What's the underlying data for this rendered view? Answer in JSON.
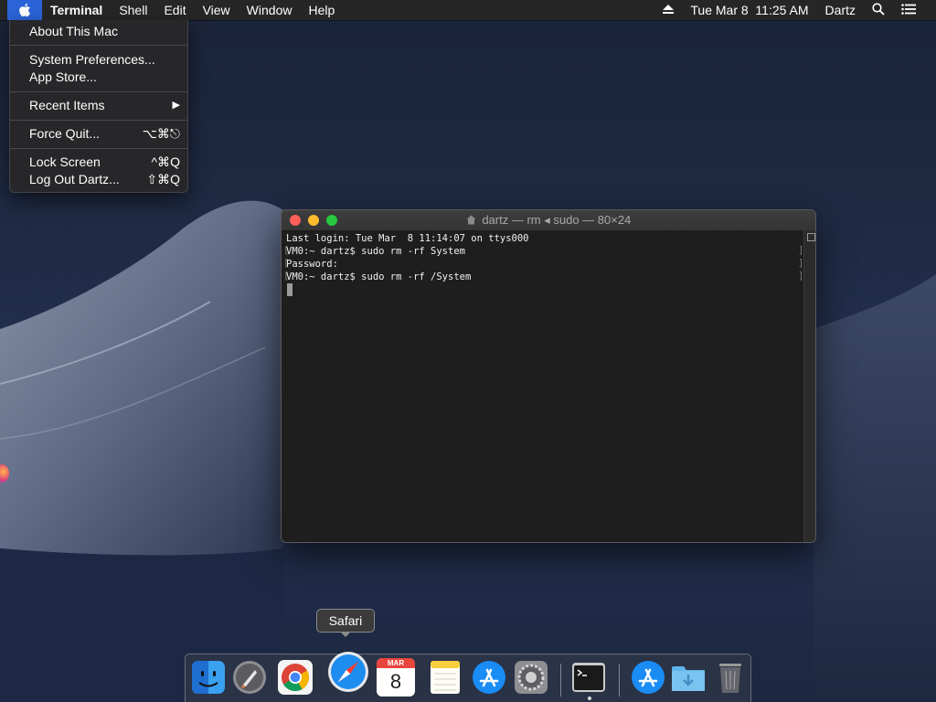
{
  "menubar": {
    "app_name": "Terminal",
    "menus": [
      "Shell",
      "Edit",
      "View",
      "Window",
      "Help"
    ],
    "datetime": "Tue Mar 8  11:25 AM",
    "user": "Dartz"
  },
  "apple_menu": {
    "items": [
      {
        "label": "About This Mac",
        "shortcut": ""
      },
      {
        "label": "System Preferences...",
        "shortcut": ""
      },
      {
        "label": "App Store...",
        "shortcut": ""
      },
      {
        "label": "Recent Items",
        "shortcut": "▶"
      },
      {
        "label": "Force Quit...",
        "shortcut": "⌥⌘⎋"
      },
      {
        "label": "Lock Screen",
        "shortcut": "^⌘Q"
      },
      {
        "label": "Log Out Dartz...",
        "shortcut": "⇧⌘Q"
      }
    ]
  },
  "terminal": {
    "title": "dartz — rm ◂ sudo — 80×24",
    "lines": [
      "Last login: Tue Mar  8 11:14:07 on ttys000",
      "VM0:~ dartz$ sudo rm -rf System",
      "Password:",
      "VM0:~ dartz$ sudo rm -rf /System"
    ]
  },
  "dock": {
    "tooltip": "Safari",
    "calendar_month": "MAR",
    "calendar_day": "8"
  },
  "icons": {
    "apple": "apple-icon",
    "eject": "eject-icon",
    "search": "spotlight-search-icon",
    "list": "notification-center-icon"
  }
}
